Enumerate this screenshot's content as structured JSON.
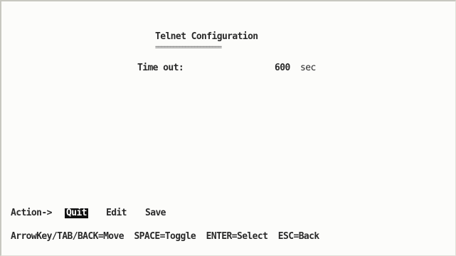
{
  "screen": {
    "title": "Telnet Configuration",
    "title_underline": "======================"
  },
  "fields": [
    {
      "label": "Time out:",
      "value": "600",
      "unit": "sec"
    }
  ],
  "action_bar": {
    "prefix": "Action->",
    "items": [
      {
        "label": "Quit",
        "selected": true
      },
      {
        "label": "Edit",
        "selected": false
      },
      {
        "label": "Save",
        "selected": false
      }
    ]
  },
  "help_line": "ArrowKey/TAB/BACK=Move  SPACE=Toggle  ENTER=Select  ESC=Back"
}
